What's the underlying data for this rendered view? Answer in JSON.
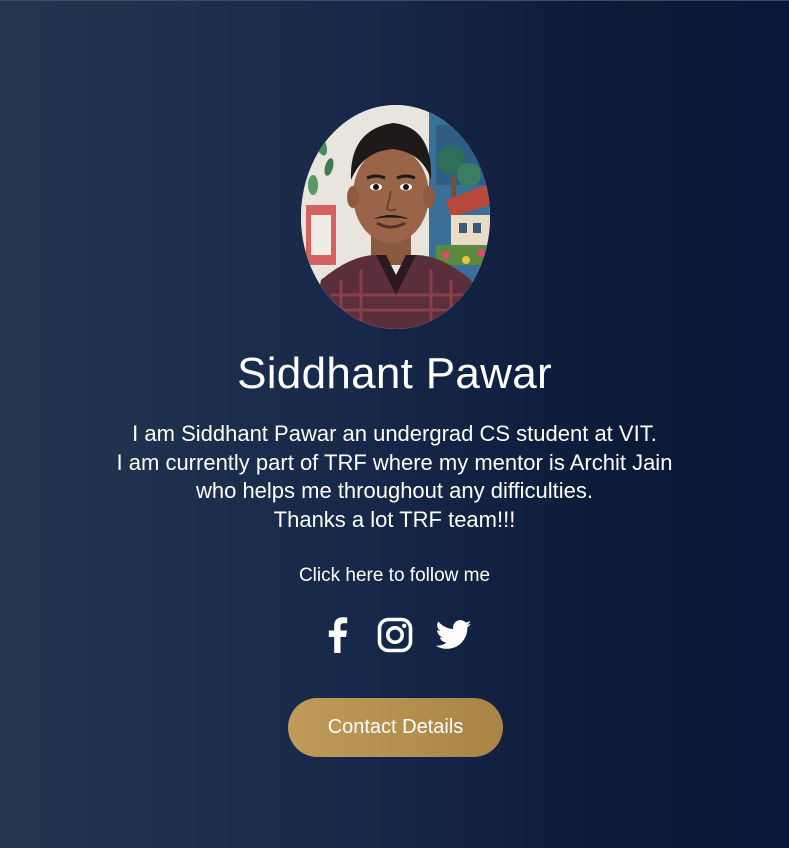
{
  "profile": {
    "name": "Siddhant Pawar",
    "bio_lines": [
      "I am Siddhant Pawar an undergrad CS student at VIT.",
      "I am currently part of TRF where my mentor is Archit Jain",
      "who helps me throughout any difficulties.",
      "Thanks a lot TRF team!!!"
    ],
    "follow_text": "Click here to follow me"
  },
  "socials": [
    {
      "icon": "facebook-icon"
    },
    {
      "icon": "instagram-icon"
    },
    {
      "icon": "twitter-icon"
    }
  ],
  "contact": {
    "button_label": "Contact Details"
  },
  "colors": {
    "background_left": "#233750",
    "background_right": "#08173a",
    "text": "#ffffff",
    "button": "#b5904f"
  }
}
